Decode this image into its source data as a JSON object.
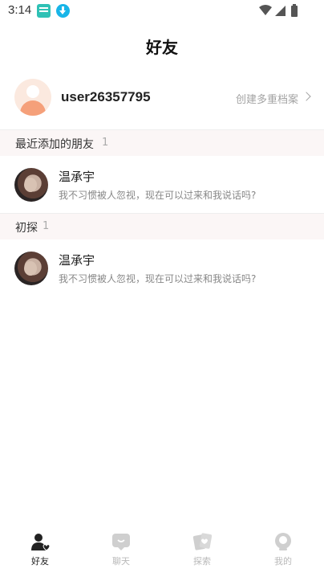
{
  "status_bar": {
    "time": "3:14"
  },
  "header": {
    "title": "好友"
  },
  "profile": {
    "username": "user26357795",
    "multi_profile_link": "创建多重档案"
  },
  "sections": [
    {
      "title": "最近添加的朋友",
      "count": "1",
      "friends": [
        {
          "name": "温承宇",
          "message": "我不习惯被人忽视，现在可以过来和我说话吗?"
        }
      ]
    },
    {
      "title": "初探",
      "count": "1",
      "friends": [
        {
          "name": "温承宇",
          "message": "我不习惯被人忽视，现在可以过来和我说话吗?"
        }
      ]
    }
  ],
  "tabs": [
    {
      "label": "好友",
      "icon": "friends-icon",
      "active": true
    },
    {
      "label": "聊天",
      "icon": "chat-icon",
      "active": false
    },
    {
      "label": "探索",
      "icon": "explore-icon",
      "active": false
    },
    {
      "label": "我的",
      "icon": "profile-icon",
      "active": false
    }
  ],
  "colors": {
    "accent_avatar": "#f5a07a",
    "section_bg": "#fbf6f6",
    "tab_inactive": "#b9b9b9",
    "tab_active": "#222222"
  }
}
